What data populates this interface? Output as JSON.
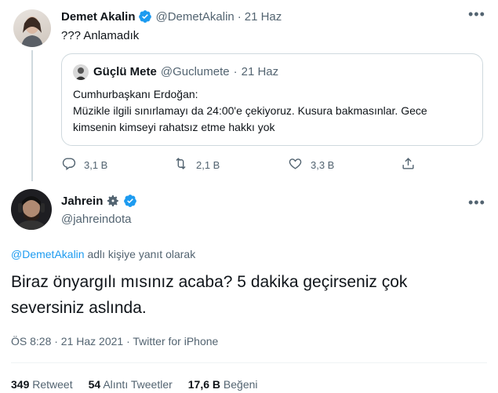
{
  "tweet1": {
    "name": "Demet Akalin",
    "handle": "@DemetAkalin",
    "sep": "·",
    "time": "21 Haz",
    "text": "??? Anlamadık",
    "more_label": "•••"
  },
  "quote": {
    "name": "Güçlü Mete",
    "handle": "@Guclumete",
    "sep": "·",
    "time": "21 Haz",
    "line1": "Cumhurbaşkanı Erdoğan:",
    "line2": "Müzikle ilgili sınırlamayı da 24:00'e çekiyoruz. Kusura bakmasınlar. Gece",
    "line3": "kimsenin kimseyi rahatsız etme hakkı yok"
  },
  "actions": {
    "reply_count": "3,1 B",
    "retweet_count": "2,1 B",
    "like_count": "3,3 B"
  },
  "tweet2": {
    "name": "Jahrein",
    "handle": "@jahreindota",
    "more_label": "•••",
    "reply_to_handle": "@DemetAkalin",
    "reply_to_suffix": "adlı kişiye yanıt olarak",
    "text_line1": "Biraz önyargılı mısınız acaba? 5 dakika geçirseniz çok",
    "text_line2": "seversiniz aslında.",
    "meta": "ÖS 8:28 · 21 Haz 2021 · Twitter for iPhone"
  },
  "stats": {
    "retweets_num": "349",
    "retweets_label": "Retweet",
    "quotes_num": "54",
    "quotes_label": "Alıntı Tweetler",
    "likes_num": "17,6 B",
    "likes_label": "Beğeni"
  },
  "colors": {
    "accent": "#1d9bf0",
    "secondary_text": "#536471",
    "border": "#cfd9de"
  },
  "icons": [
    "verified-badge-icon",
    "settings-gear-icon",
    "reply-icon",
    "retweet-icon",
    "like-icon",
    "share-icon",
    "more-icon"
  ]
}
